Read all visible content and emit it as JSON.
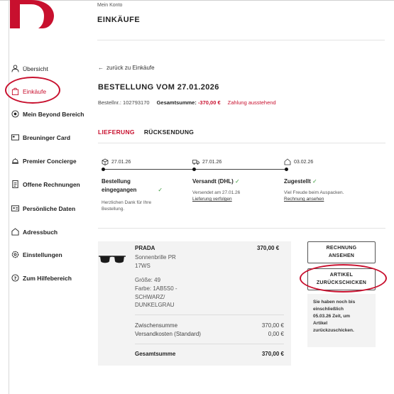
{
  "header": {
    "account_label": "Mein Konto",
    "page_heading": "EINKÄUFE"
  },
  "sidebar": {
    "items": [
      {
        "label": "Übersicht",
        "icon": "person-icon"
      },
      {
        "label": "Einkäufe",
        "icon": "shopping-bag-icon",
        "active": true
      },
      {
        "label": "Mein Beyond Bereich",
        "icon": "beyond-badge-icon"
      },
      {
        "label": "Breuninger Card",
        "icon": "card-icon"
      },
      {
        "label": "Premier Concierge",
        "icon": "concierge-icon"
      },
      {
        "label": "Offene Rechnungen",
        "icon": "invoice-icon"
      },
      {
        "label": "Persönliche Daten",
        "icon": "id-card-icon"
      },
      {
        "label": "Adressbuch",
        "icon": "house-icon"
      },
      {
        "label": "Einstellungen",
        "icon": "gear-icon"
      },
      {
        "label": "Zum Hilfebereich",
        "icon": "help-icon"
      }
    ]
  },
  "order": {
    "back_link": "zurück zu Einkäufe",
    "title": "BESTELLUNG VOM 27.01.2026",
    "order_number": "Bestellnr.: 102793170",
    "total_label": "Gesamtsumme:",
    "total_value": "-370,00 €",
    "payment_status": "Zahlung ausstehend"
  },
  "tabs": [
    "LIEFERUNG",
    "RÜCKSENDUNG"
  ],
  "timeline": {
    "steps": [
      {
        "date": "27.01.26",
        "title_line1": "Bestellung",
        "title_line2": "eingegangen",
        "text_line1": "Herzlichen Dank für Ihre",
        "text_line2": "Bestellung."
      },
      {
        "date": "27.01.26",
        "title": "Versandt (DHL)",
        "text": "Versendet am 27.01.26",
        "link": "Lieferung verfolgen"
      },
      {
        "date": "03.02.26",
        "title": "Zugestellt",
        "text": "Viel Freude beim Auspacken.",
        "link": "Rechnung ansehen"
      }
    ],
    "check": "✓"
  },
  "item": {
    "brand": "PRADA",
    "name_line1": "Sonnenbrille PR",
    "name_line2": "17WS",
    "price": "370,00 €",
    "size": "Größe: 49",
    "color_line1": "Farbe: 1AB5S0 -",
    "color_line2": "SCHWARZ/",
    "color_line3": "DUNKELGRAU"
  },
  "summary": {
    "subtotal_label": "Zwischensumme",
    "subtotal_value": "370,00 €",
    "shipping_label": "Versandkosten (Standard)",
    "shipping_value": "0,00 €",
    "total_label": "Gesamtsumme",
    "total_value": "370,00 €"
  },
  "actions": {
    "invoice_line1": "RECHNUNG",
    "invoice_line2": "ANSEHEN",
    "return_line1": "ARTIKEL",
    "return_line2": "ZURÜCKSCHICKEN",
    "note_lines": [
      "Sie haben noch bis",
      "einschließlich",
      "05.03.26 Zeit, um",
      "Artikel",
      "zurückzuschicken."
    ]
  },
  "colors": {
    "brand": "#c8102e",
    "success": "#3a9a3a"
  }
}
